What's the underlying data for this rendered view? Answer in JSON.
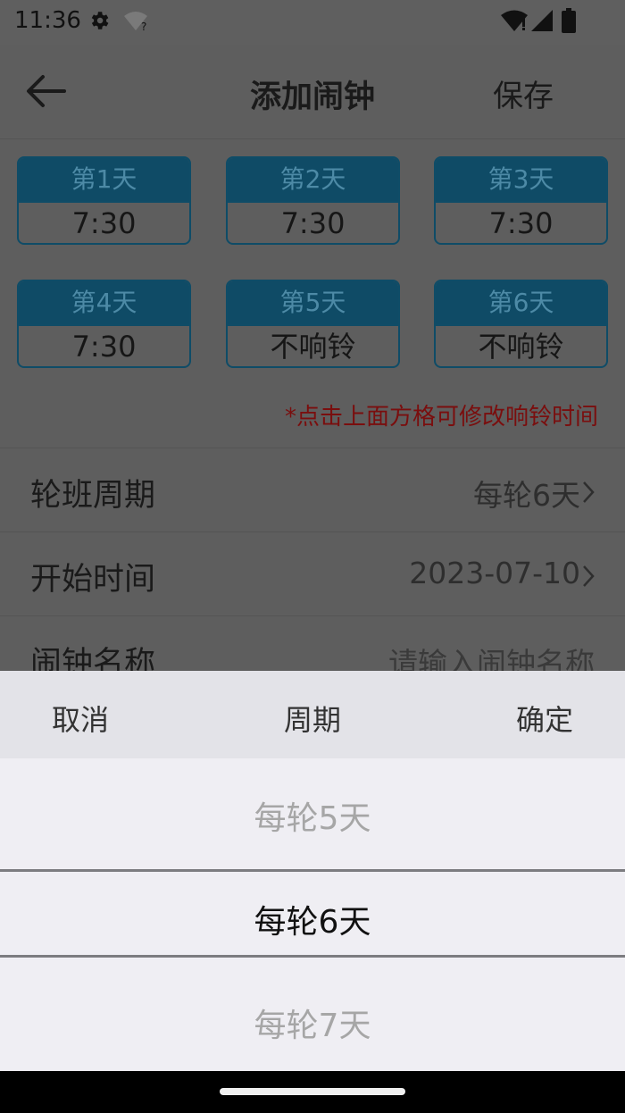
{
  "status_bar": {
    "time": "11:36",
    "icons": [
      "gear-icon",
      "wifi-question-icon",
      "wifi-icon",
      "signal-icon",
      "battery-icon"
    ]
  },
  "app_bar": {
    "back_icon": "arrow-left-icon",
    "title": "添加闹钟",
    "save_label": "保存"
  },
  "days": [
    {
      "label": "第1天",
      "value": "7:30"
    },
    {
      "label": "第2天",
      "value": "7:30"
    },
    {
      "label": "第3天",
      "value": "7:30"
    },
    {
      "label": "第4天",
      "value": "7:30"
    },
    {
      "label": "第5天",
      "value": "不响铃"
    },
    {
      "label": "第6天",
      "value": "不响铃"
    }
  ],
  "hint": "*点击上面方格可修改响铃时间",
  "settings": {
    "cycle": {
      "label": "轮班周期",
      "value": "每轮6天"
    },
    "start": {
      "label": "开始时间",
      "value": "2023-07-10"
    },
    "name": {
      "label": "闹钟名称",
      "placeholder": "请输入闹钟名称"
    }
  },
  "picker": {
    "cancel_label": "取消",
    "title": "周期",
    "confirm_label": "确定",
    "options": [
      "每轮5天",
      "每轮6天",
      "每轮7天"
    ],
    "selected": "每轮6天"
  },
  "colors": {
    "card_header": "#0f4b66",
    "hint_text": "#7a0e0e",
    "overlay": "#5e5e5e",
    "sheet": "#efeef3"
  }
}
